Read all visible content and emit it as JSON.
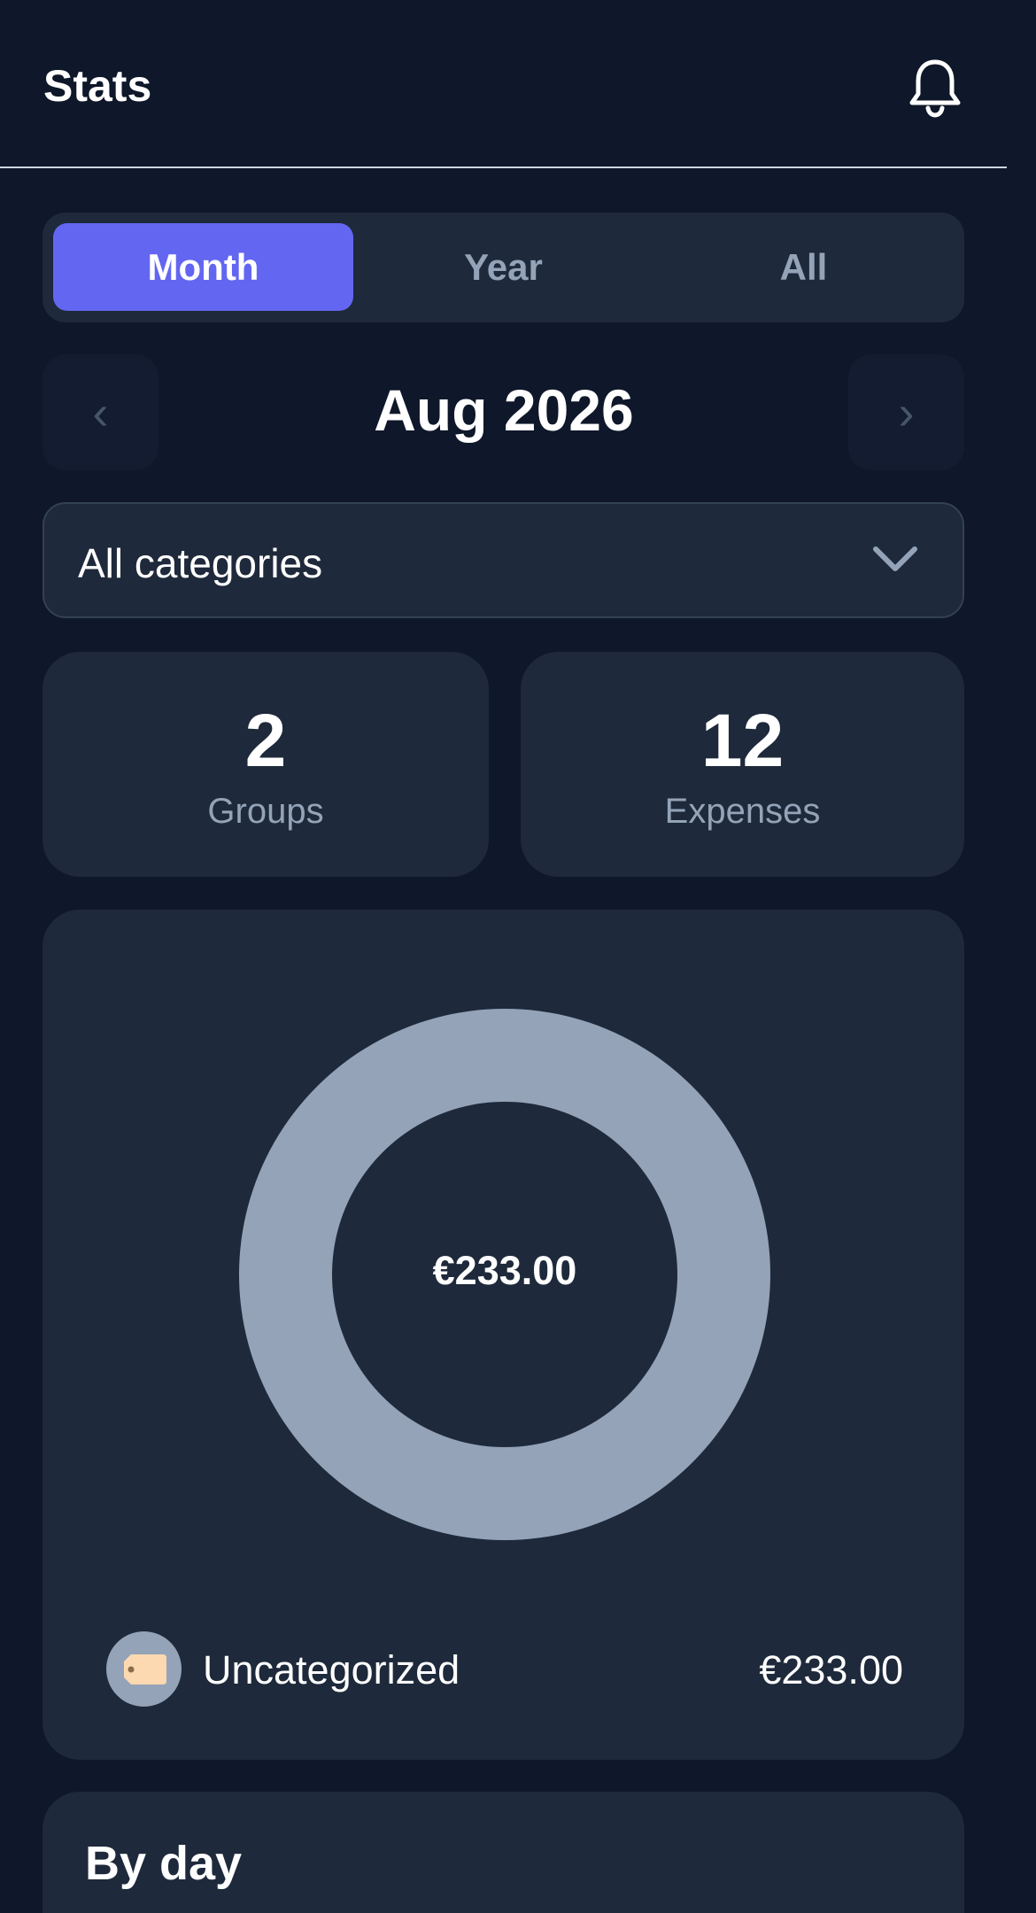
{
  "header": {
    "title": "Stats",
    "notification_icon": "bell-icon"
  },
  "period_tabs": [
    {
      "label": "Month",
      "active": true
    },
    {
      "label": "Year",
      "active": false
    },
    {
      "label": "All",
      "active": false
    }
  ],
  "period_nav": {
    "prev_glyph": "‹",
    "next_glyph": "›",
    "label": "Aug 2026"
  },
  "category_filter": {
    "value": "All categories",
    "icon": "chevron-down-icon"
  },
  "summary": {
    "groups": {
      "value": "2",
      "label": "Groups"
    },
    "expenses": {
      "value": "12",
      "label": "Expenses"
    }
  },
  "breakdown": {
    "total": "€233.00",
    "items": [
      {
        "label": "Uncategorized",
        "amount": "€233.00",
        "icon": "tag-icon",
        "color": "#94a3b8"
      }
    ]
  },
  "chart_data": {
    "type": "pie",
    "categories": [
      "Uncategorized"
    ],
    "values": [
      233.0
    ],
    "colors": [
      "#94a3b8"
    ],
    "donut": true,
    "center_label": "€233.00"
  },
  "by_day": {
    "title": "By day"
  },
  "colors": {
    "background": "#0f172a",
    "card": "#1e293b",
    "accent": "#6366f1",
    "muted_text": "#94a3b8"
  }
}
